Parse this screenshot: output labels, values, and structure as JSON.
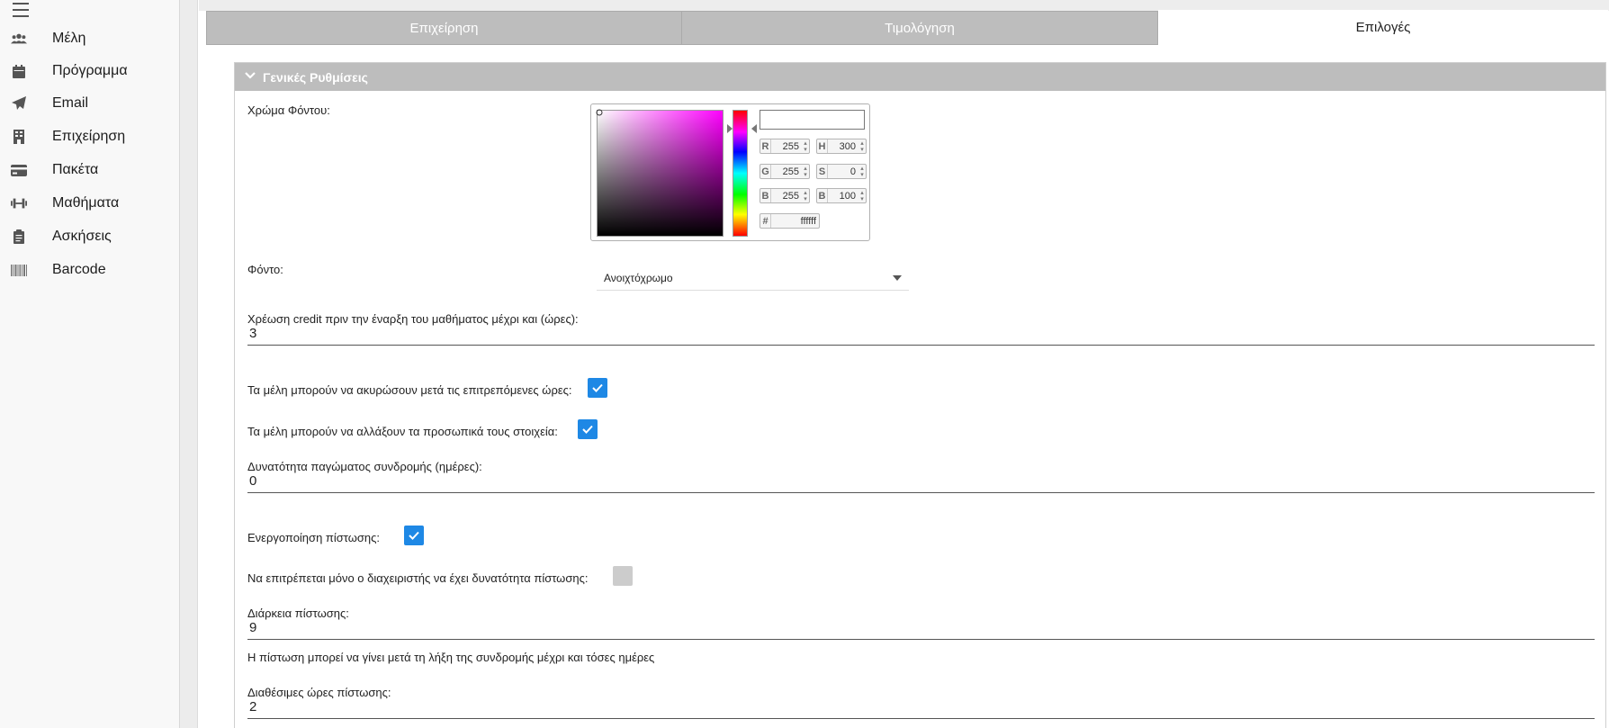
{
  "sidebar": {
    "items": [
      {
        "label": "Μέλη",
        "icon": "users-icon"
      },
      {
        "label": "Πρόγραμμα",
        "icon": "calendar-icon"
      },
      {
        "label": "Email",
        "icon": "paper-plane-icon"
      },
      {
        "label": "Επιχείρηση",
        "icon": "building-icon"
      },
      {
        "label": "Πακέτα",
        "icon": "credit-card-icon"
      },
      {
        "label": "Μαθήματα",
        "icon": "dumbbell-icon"
      },
      {
        "label": "Ασκήσεις",
        "icon": "clipboard-icon"
      },
      {
        "label": "Barcode",
        "icon": "barcode-icon"
      }
    ]
  },
  "tabs": [
    {
      "label": "Επιχείρηση",
      "active": false
    },
    {
      "label": "Τιμολόγηση",
      "active": false
    },
    {
      "label": "Επιλογές",
      "active": true
    }
  ],
  "panel": {
    "title": "Γενικές Ρυθμίσεις"
  },
  "form": {
    "bg_color_label": "Χρώμα Φόντου:",
    "color_picker": {
      "preview_color": "#ffffff",
      "r_label": "R",
      "r": "255",
      "g_label": "G",
      "g": "255",
      "b_label": "B",
      "b": "255",
      "h_label": "H",
      "h": "300",
      "s_label": "S",
      "s": "0",
      "br_label": "B",
      "br": "100",
      "hex_label": "#",
      "hex": "ffffff"
    },
    "background_label": "Φόντο:",
    "background_value": "Ανοιχτόχρωμο",
    "credit_charge_label": "Χρέωση credit πριν την έναρξη του μαθήματος μέχρι και (ώρες):",
    "credit_charge_value": "3",
    "cancel_after_label": "Τα μέλη μπορούν να ακυρώσουν μετά τις επιτρεπόμενες ώρες:",
    "cancel_after_checked": true,
    "edit_personal_label": "Τα μέλη μπορούν να αλλάξουν τα προσωπικά τους στοιχεία:",
    "edit_personal_checked": true,
    "freeze_label": "Δυνατότητα παγώματος συνδρομής (ημέρες):",
    "freeze_value": "0",
    "enable_credit_label": "Ενεργοποίηση πίστωσης:",
    "enable_credit_checked": true,
    "admin_only_label": "Να επιτρέπεται μόνο ο διαχειριστής να έχει δυνατότητα πίστωσης:",
    "admin_only_checked": false,
    "credit_duration_label": "Διάρκεια πίστωσης:",
    "credit_duration_value": "9",
    "credit_duration_help": "Η πίστωση μπορεί να γίνει μετά τη λήξη της συνδρομής μέχρι και τόσες ημέρες",
    "credit_hours_label": "Διαθέσιμες ώρες πίστωσης:",
    "credit_hours_value": "2"
  },
  "colors": {
    "accent": "#1e88e5",
    "tab_inactive": "#bdbdbd",
    "panel_header": "#bdbdbd"
  }
}
